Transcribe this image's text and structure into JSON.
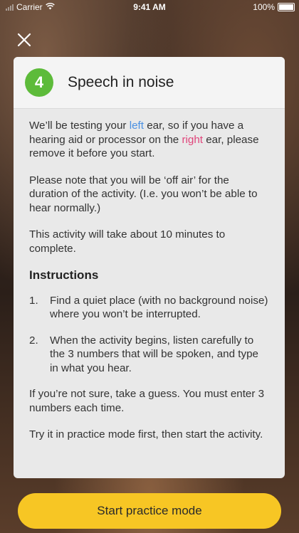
{
  "status_bar": {
    "carrier": "Carrier",
    "time": "9:41 AM",
    "battery": "100%"
  },
  "close_icon": "close-icon",
  "card": {
    "step_number": "4",
    "title": "Speech in noise",
    "intro": {
      "part1": "We’ll be testing your ",
      "left_word": "left",
      "part2": " ear, so if you have a hearing aid or processor on the ",
      "right_word": "right",
      "part3": " ear, please remove it before you start."
    },
    "off_air": "Please note that you will be ‘off air’ for the duration of the activity. (I.e. you won’t be able to hear normally.)",
    "duration": "This activity will take about 10 minutes to complete.",
    "instructions_heading": "Instructions",
    "steps": [
      {
        "num": "1.",
        "text": "Find a quiet place (with no background noise) where you won’t be interrupted."
      },
      {
        "num": "2.",
        "text": "When the activity begins, listen carefully to the 3 numbers that will be spoken, and type in what you hear."
      }
    ],
    "guess_note": "If you’re not sure, take a guess. You must enter 3 numbers each time.",
    "practice_note": "Try it in practice mode first, then start the activity."
  },
  "cta_label": "Start practice mode",
  "colors": {
    "badge": "#5dbb3a",
    "left_highlight": "#4a90e2",
    "right_highlight": "#e0457b",
    "cta": "#f7c624"
  }
}
